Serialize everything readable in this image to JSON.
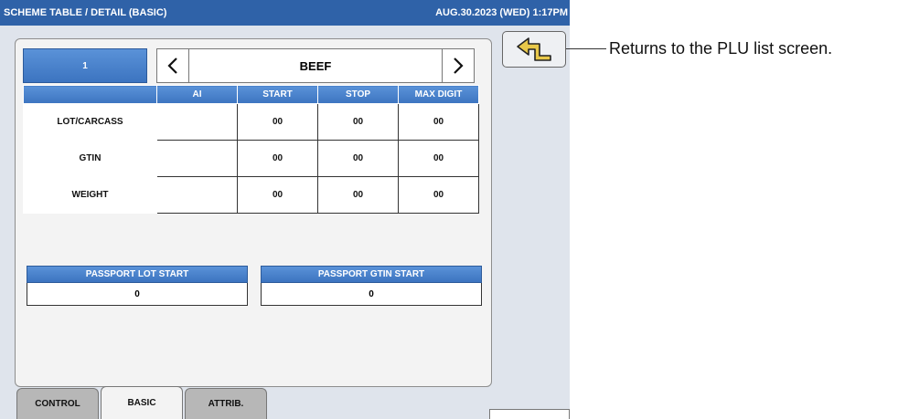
{
  "window": {
    "title": "SCHEME TABLE / DETAIL (BASIC)",
    "datetime": "AUG.30.2023 (WED)  1:17PM"
  },
  "record": {
    "number": "1",
    "name": "BEEF"
  },
  "grid": {
    "headers": [
      "",
      "AI",
      "START",
      "STOP",
      "MAX DIGIT"
    ],
    "rows": [
      {
        "label": "LOT/CARCASS",
        "ai": "",
        "start": "00",
        "stop": "00",
        "max_digit": "00"
      },
      {
        "label": "GTIN",
        "ai": "",
        "start": "00",
        "stop": "00",
        "max_digit": "00"
      },
      {
        "label": "WEIGHT",
        "ai": "",
        "start": "00",
        "stop": "00",
        "max_digit": "00"
      }
    ]
  },
  "passport": {
    "lot_start_label": "PASSPORT LOT START",
    "lot_start_value": "0",
    "gtin_start_label": "PASSPORT GTIN START",
    "gtin_start_value": "0"
  },
  "tabs": [
    {
      "label": "CONTROL",
      "active": false
    },
    {
      "label": "BASIC",
      "active": true
    },
    {
      "label": "ATTRIB.",
      "active": false
    }
  ],
  "icons": {
    "back": "return-arrow-icon",
    "prev": "chevron-left-icon",
    "next": "chevron-right-icon"
  },
  "annotation": {
    "back_button_note": "Returns to the PLU list screen."
  },
  "colors": {
    "title_bar": "#2f62a8",
    "header_blue": "#4a84cc",
    "screen_bg": "#dfe4ec",
    "back_arrow": "#e8c84a"
  }
}
